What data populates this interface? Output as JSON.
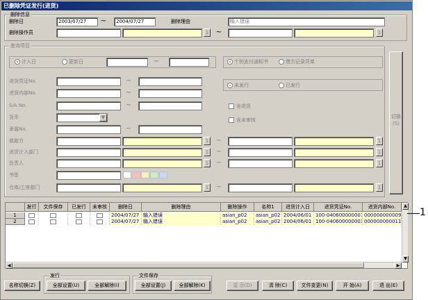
{
  "window": {
    "title": "已删除凭证发行(进货)"
  },
  "delete_info": {
    "group_label": "删除信息",
    "date_label": "删除日",
    "date_from": "2003/07/27",
    "tilde": "~",
    "date_to": "2004/07/27",
    "reason_label": "删除理由",
    "reason_value": "输入错误",
    "operator_label": "删除操作员",
    "lookup_btn": "1"
  },
  "search": {
    "group_label": "查询项目",
    "radio_plan_date": "计入日",
    "radio_update_date": "更新日",
    "radio_individual": "个别支付通知书",
    "radio_credit": "借方记录凭单",
    "voucher_no_label": "进货凭证No.",
    "internal_no_label": "进货内部No.",
    "sa_no_label": "S/A No.",
    "currency_label": "货币",
    "ticket_no_label": "承酱No.",
    "payee_label": "收款方",
    "dept_label": "进货计入部门",
    "manager_label": "负责人",
    "notes_label": "书签",
    "warehouse_label": "仓库/工序部门",
    "radio_unissued": "未发行",
    "radio_issued": "已发行",
    "chk_returns": "含退货",
    "chk_unreviewed": "含未审核",
    "switch_btn": "切换(S)"
  },
  "grid": {
    "headers": [
      "发行",
      "文件保存",
      "已发行",
      "未审核",
      "删除日",
      "删除理由",
      "删除操作",
      "名称1",
      "进货计入日",
      "进货凭证No.",
      "进货内部No."
    ],
    "rows": [
      {
        "num": "1",
        "date": "2004/07/27",
        "reason": "输入错误",
        "op": "asian_p02",
        "name": "asian_p02",
        "plan": "2004/06/01",
        "voucher": "100-040600000001",
        "internal": "000000000009"
      },
      {
        "num": "2",
        "date": "2004/07/27",
        "reason": "输入错误",
        "op": "asian_p02",
        "name": "asian_p02",
        "plan": "2004/06/01",
        "voucher": "100-040600000003",
        "internal": "000000000011"
      }
    ]
  },
  "callout": "1",
  "bottom": {
    "name_switch": "名称切换(Z)",
    "issue_group": "发行",
    "issue_all_set": "全部设置(U)",
    "issue_all_clear": "全部解除(I)",
    "file_group": "文件保存",
    "file_all_set": "全部设置(J)",
    "file_all_clear": "全部解除(K)",
    "display": "显 示(D)",
    "clear": "清 除(C)",
    "file_change": "文件变更(N)",
    "start": "开 始(A)",
    "exit": "退 出(E)"
  }
}
